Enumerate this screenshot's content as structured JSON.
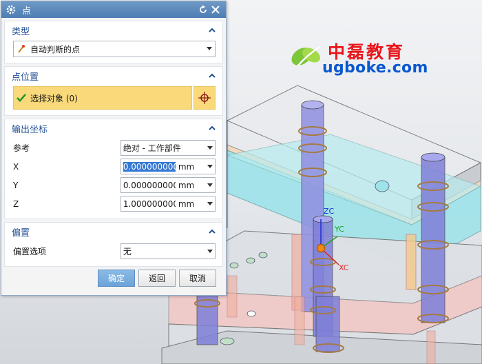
{
  "dialog": {
    "title": "点",
    "sections": {
      "type": {
        "header": "类型",
        "dropdown_value": "自动判断的点"
      },
      "point_location": {
        "header": "点位置",
        "select_object_label": "选择对象 (0)"
      },
      "output_coords": {
        "header": "输出坐标",
        "reference_label": "参考",
        "reference_value": "绝对 - 工作部件",
        "x_label": "X",
        "x_value": "0.0000000000",
        "y_label": "Y",
        "y_value": "0.0000000000",
        "z_label": "Z",
        "z_value": "1.0000000000",
        "unit": "mm"
      },
      "offset": {
        "header": "偏置",
        "offset_option_label": "偏置选项",
        "offset_option_value": "无"
      }
    },
    "buttons": {
      "ok": "确定",
      "back": "返回",
      "cancel": "取消"
    }
  },
  "watermark": {
    "title": "中磊教育",
    "url": "ugboke.com"
  },
  "triad": {
    "zc": "ZC",
    "yc": "YC",
    "xc": "XC"
  },
  "colors": {
    "title_bar": "#5a88bc",
    "section_header_text": "#1f4f93",
    "selection_highlight": "#f9d97a",
    "ok_button": "#7aafe0",
    "brand_red": "#e8161b",
    "brand_blue": "#0a58cf"
  }
}
